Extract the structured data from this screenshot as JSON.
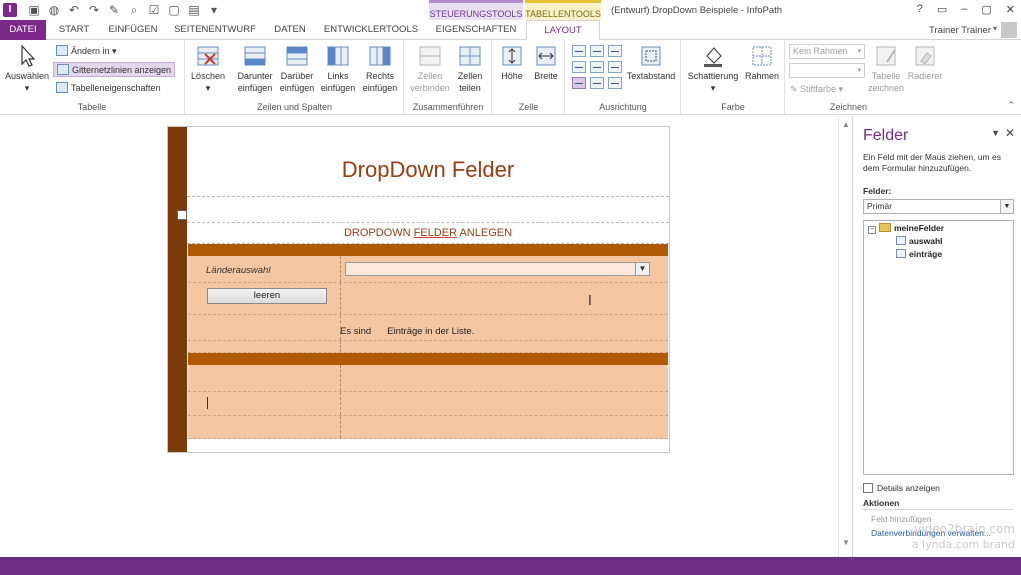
{
  "app": {
    "window_title": "(Entwurf) DropDown Beispiele - InfoPath",
    "context_groups": [
      "STEUERUNGSTOOLS",
      "TABELLENTOOLS"
    ],
    "window_controls": [
      "?",
      "▭",
      "–",
      "▢",
      "✕"
    ],
    "user": "Trainer Trainer"
  },
  "qat": [
    "save-icon",
    "globe-icon",
    "undo-icon",
    "redo-icon",
    "format-painter-icon",
    "print-preview-icon",
    "check-icon",
    "new-doc-icon",
    "view-icon",
    "customize-icon"
  ],
  "tabs": [
    "DATEI",
    "START",
    "EINFÜGEN",
    "SEITENENTWURF",
    "DATEN",
    "ENTWICKLERTOOLS",
    "EIGENSCHAFTEN",
    "LAYOUT"
  ],
  "ribbon": {
    "tabelle": {
      "label": "Tabelle",
      "auswaehlen": "Auswählen",
      "aendern": "Ändern in",
      "gitter": "Gitternetzlinien anzeigen",
      "eigenschaften": "Tabelleneigenschaften"
    },
    "zeilen": {
      "label": "Zeilen und Spalten",
      "loeschen": "Löschen",
      "darunter1": "Darunter",
      "darunter2": "einfügen",
      "darueber1": "Darüber",
      "darueber2": "einfügen",
      "links1": "Links",
      "links2": "einfügen",
      "rechts1": "Rechts",
      "rechts2": "einfügen"
    },
    "zusammen": {
      "label": "Zusammenführen",
      "verbinden1": "Zellen",
      "verbinden2": "verbinden",
      "teilen1": "Zellen",
      "teilen2": "teilen"
    },
    "zelle": {
      "label": "Zelle",
      "hoehe": "Höhe",
      "breite": "Breite"
    },
    "ausrichtung": {
      "label": "Ausrichtung",
      "textabstand": "Textabstand"
    },
    "farbe": {
      "label": "Farbe",
      "schattierung": "Schattierung",
      "rahmen": "Rahmen"
    },
    "zeichnen": {
      "label": "Zeichnen",
      "kein_rahmen": "Kein Rahmen",
      "stiftfarbe": "Stiftfarbe",
      "tabelle_zeichnen1": "Tabelle",
      "tabelle_zeichnen2": "zeichnen",
      "radierer": "Radierer"
    }
  },
  "form": {
    "title": "DropDown Felder",
    "section_before": "DROPDOWN ",
    "section_underlined": "FELDER",
    "section_after": " ANLEGEN",
    "label_laender": "Länderauswahl",
    "button_leeren": "leeren",
    "info_prefix": "Es sind",
    "info_suffix": "Einträge in der Liste."
  },
  "pane": {
    "title": "Felder",
    "description": "Ein Feld mit der Maus ziehen, um es dem Formular hinzuzufügen.",
    "fields_label": "Felder:",
    "source": "Primär",
    "tree": {
      "root": "meineFelder",
      "children": [
        "auswahl",
        "einträge"
      ]
    },
    "details": "Details anzeigen",
    "actions": "Aktionen",
    "link_add": "Feld hinzufügen",
    "link_manage": "Datenverbindungen verwalten...",
    "watermark1": "video2brain.com",
    "watermark2": "a lynda.com brand"
  }
}
